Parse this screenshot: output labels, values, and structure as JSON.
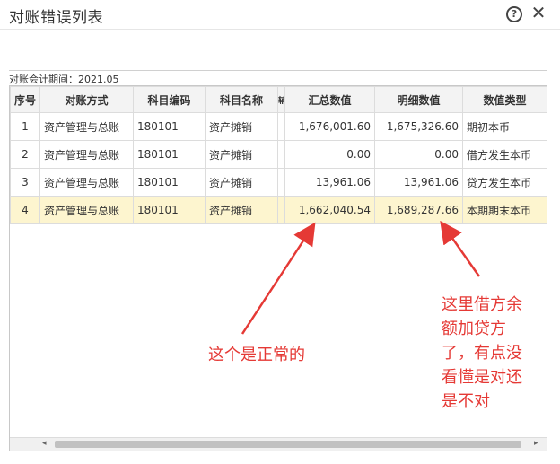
{
  "window": {
    "title": "对账错误列表",
    "help_glyph": "?",
    "close_glyph": "✕"
  },
  "period_label": "对账会计期间：2021.05",
  "grid": {
    "columns": [
      "序号",
      "对账方式",
      "科目编码",
      "科目名称",
      "辅",
      "汇总数值",
      "明细数值",
      "数值类型"
    ],
    "rows": [
      {
        "index": "1",
        "method": "资产管理与总账",
        "code": "180101",
        "name": "资产摊销",
        "aux": "",
        "summary": "1,676,001.60",
        "detail": "1,675,326.60",
        "type": "期初本币"
      },
      {
        "index": "2",
        "method": "资产管理与总账",
        "code": "180101",
        "name": "资产摊销",
        "aux": "",
        "summary": "0.00",
        "detail": "0.00",
        "type": "借方发生本币"
      },
      {
        "index": "3",
        "method": "资产管理与总账",
        "code": "180101",
        "name": "资产摊销",
        "aux": "",
        "summary": "13,961.06",
        "detail": "13,961.06",
        "type": "贷方发生本币"
      },
      {
        "index": "4",
        "method": "资产管理与总账",
        "code": "180101",
        "name": "资产摊销",
        "aux": "",
        "summary": "1,662,040.54",
        "detail": "1,689,287.66",
        "type": "本期期末本币"
      }
    ],
    "selected_row_index": 3,
    "scrollbar": {
      "left_glyph": "◂",
      "right_glyph": "▸"
    }
  },
  "annotations": {
    "normal_note": "这个是正常的",
    "question_note": [
      "这里借方余",
      "额加贷方",
      "了，有点没",
      "看懂是对还",
      "是不对"
    ],
    "color": "#e53935"
  },
  "colors": {
    "selected_row_bg": "#fdf5cf",
    "header_bg": "#f3f3f3"
  }
}
